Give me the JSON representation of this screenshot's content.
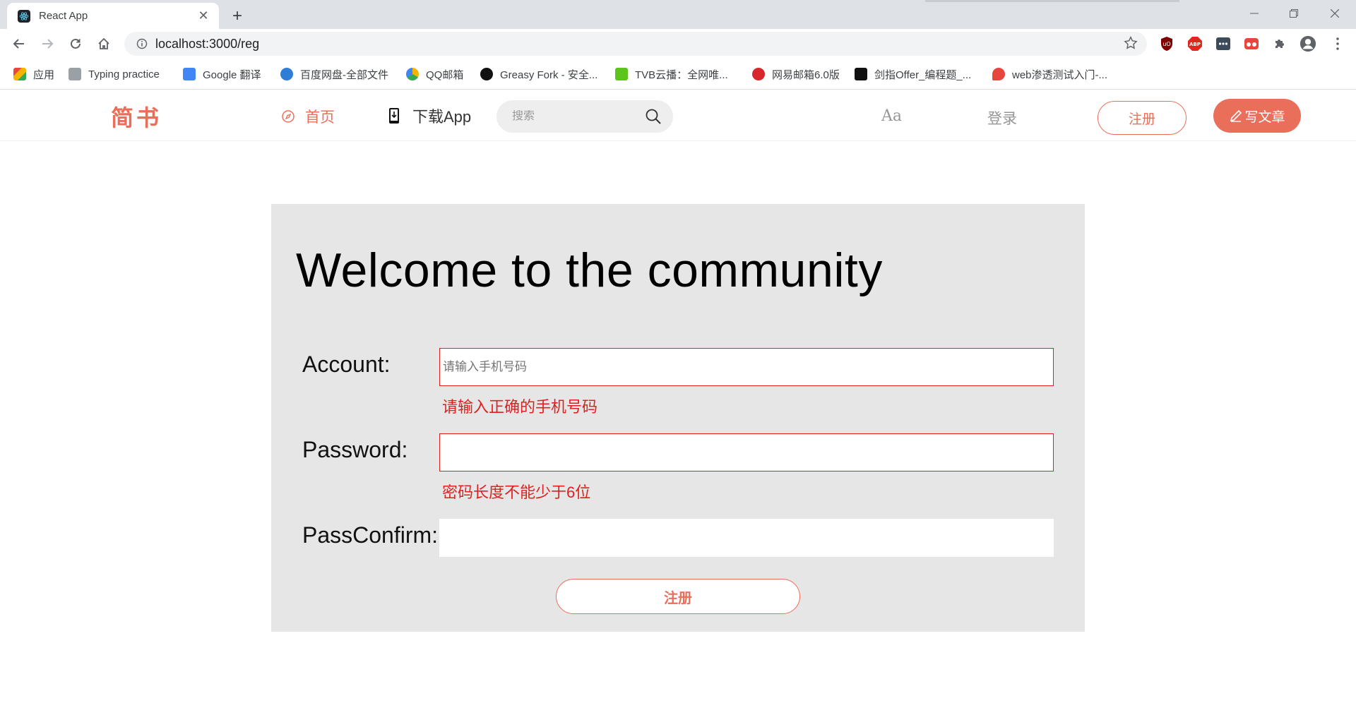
{
  "browser": {
    "tab_title": "React App",
    "tab_close": "✕",
    "new_tab": "+",
    "url": "localhost:3000/reg",
    "bookmarks": [
      {
        "label": "应用",
        "color": "#e8453c"
      },
      {
        "label": "Typing practice",
        "color": "#9aa0a6"
      },
      {
        "label": "Google 翻译",
        "color": "#4285f4"
      },
      {
        "label": "百度网盘-全部文件",
        "color": "#2e7dd7"
      },
      {
        "label": "QQ邮箱",
        "color": "#f4b400"
      },
      {
        "label": "Greasy Fork - 安全...",
        "color": "#111111"
      },
      {
        "label": "TVB云播：全网唯...",
        "color": "#5cc41b"
      },
      {
        "label": "网易邮箱6.0版",
        "color": "#d8262d"
      },
      {
        "label": "剑指Offer_编程题_...",
        "color": "#111111"
      },
      {
        "label": "web渗透测试入门-...",
        "color": "#e8453c"
      }
    ]
  },
  "header": {
    "logo": "简书",
    "nav_home": "首页",
    "nav_download": "下载App",
    "search_placeholder": "搜索",
    "aa_label": "Aa",
    "login": "登录",
    "register": "注册",
    "write": "写文章"
  },
  "form": {
    "title": "Welcome to the community",
    "account": {
      "label": "Account:",
      "placeholder": "请输入手机号码",
      "value": "",
      "error": "请输入正确的手机号码"
    },
    "password": {
      "label": "Password:",
      "value": "",
      "error": "密码长度不能少于6位"
    },
    "confirm": {
      "label": "PassConfirm:",
      "value": ""
    },
    "submit": "注册"
  },
  "colors": {
    "brand": "#ea6f5a",
    "error": "#e02020",
    "panel_bg": "#e6e6e6"
  }
}
